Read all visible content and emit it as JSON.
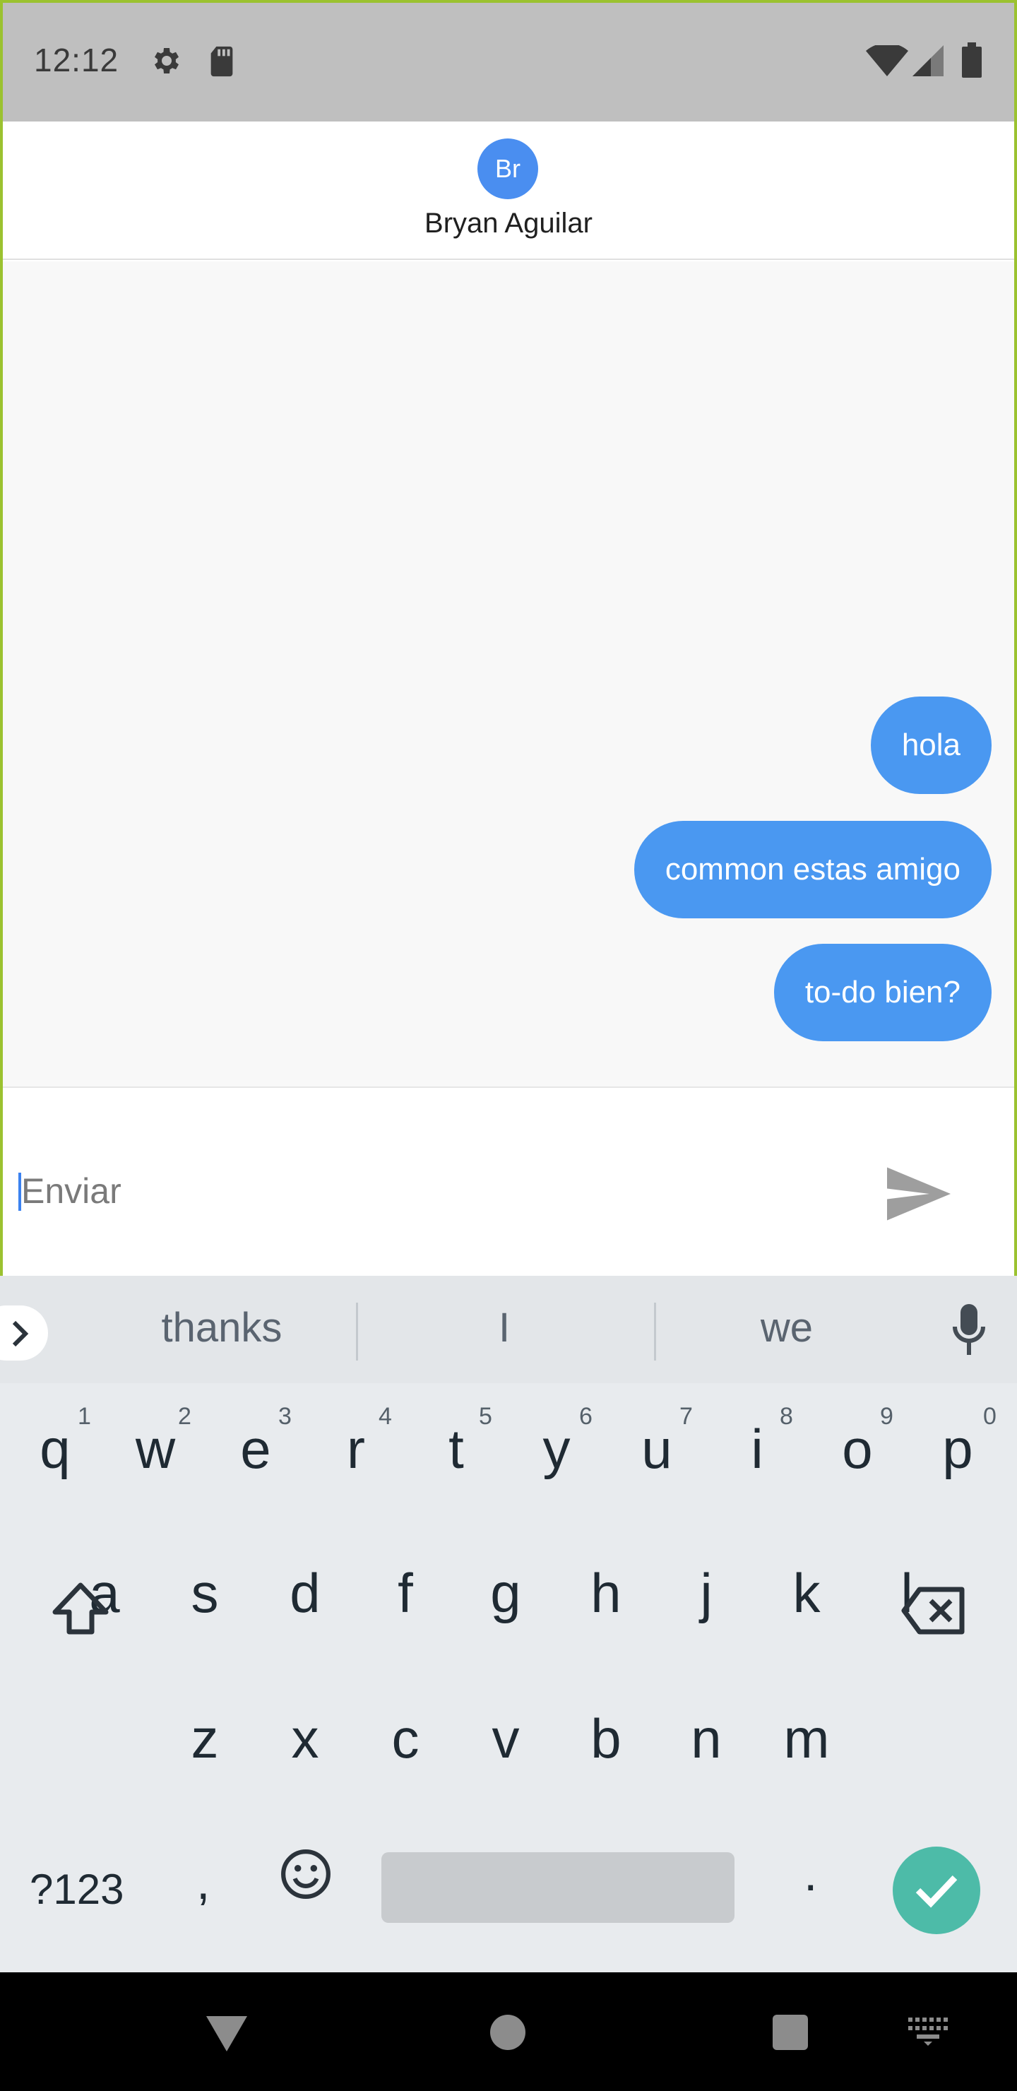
{
  "status_bar": {
    "time": "12:12",
    "icons": [
      "gear-icon",
      "sd-card-icon",
      "wifi-icon",
      "signal-icon",
      "battery-icon"
    ]
  },
  "header": {
    "avatar_initials": "Br",
    "avatar_color": "#4a8ef0",
    "contact_name": "Bryan Aguilar"
  },
  "messages": [
    {
      "text": "hola",
      "sender": "me"
    },
    {
      "text": "common estas amigo",
      "sender": "me"
    },
    {
      "text": "to-do bien?",
      "sender": "me"
    }
  ],
  "composer": {
    "placeholder": "Enviar",
    "value": "",
    "send_icon": "send-icon"
  },
  "keyboard": {
    "suggestions": [
      "thanks",
      "I",
      "we"
    ],
    "row1": [
      {
        "key": "q",
        "num": "1"
      },
      {
        "key": "w",
        "num": "2"
      },
      {
        "key": "e",
        "num": "3"
      },
      {
        "key": "r",
        "num": "4"
      },
      {
        "key": "t",
        "num": "5"
      },
      {
        "key": "y",
        "num": "6"
      },
      {
        "key": "u",
        "num": "7"
      },
      {
        "key": "i",
        "num": "8"
      },
      {
        "key": "o",
        "num": "9"
      },
      {
        "key": "p",
        "num": "0"
      }
    ],
    "row2": [
      "a",
      "s",
      "d",
      "f",
      "g",
      "h",
      "j",
      "k",
      "l"
    ],
    "row3": [
      "z",
      "x",
      "c",
      "v",
      "b",
      "n",
      "m"
    ],
    "symbols_label": "?123",
    "comma": ",",
    "period": ".",
    "accent_color": "#4dbba8"
  },
  "colors": {
    "bubble": "#4a98f1",
    "status_bar": "#bfbfbf",
    "frame": "#9bc230"
  }
}
